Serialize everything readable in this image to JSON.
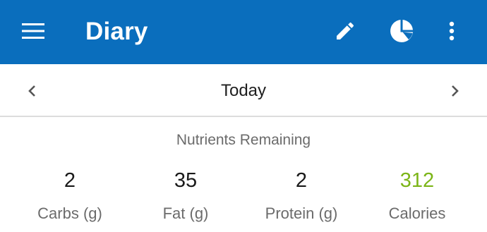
{
  "appbar": {
    "title": "Diary",
    "icons": {
      "menu": "menu-icon",
      "edit": "pencil-icon",
      "nutrition": "pie-chart-icon",
      "more": "more-vert-icon"
    },
    "background_color": "#0a6ebd"
  },
  "date_nav": {
    "label": "Today",
    "prev_icon": "chevron-left-icon",
    "next_icon": "chevron-right-icon"
  },
  "nutrients": {
    "title": "Nutrients Remaining",
    "items": [
      {
        "value": "2",
        "label": "Carbs (g)"
      },
      {
        "value": "35",
        "label": "Fat (g)"
      },
      {
        "value": "2",
        "label": "Protein (g)"
      },
      {
        "value": "312",
        "label": "Calories",
        "color": "#7cb518"
      }
    ]
  }
}
